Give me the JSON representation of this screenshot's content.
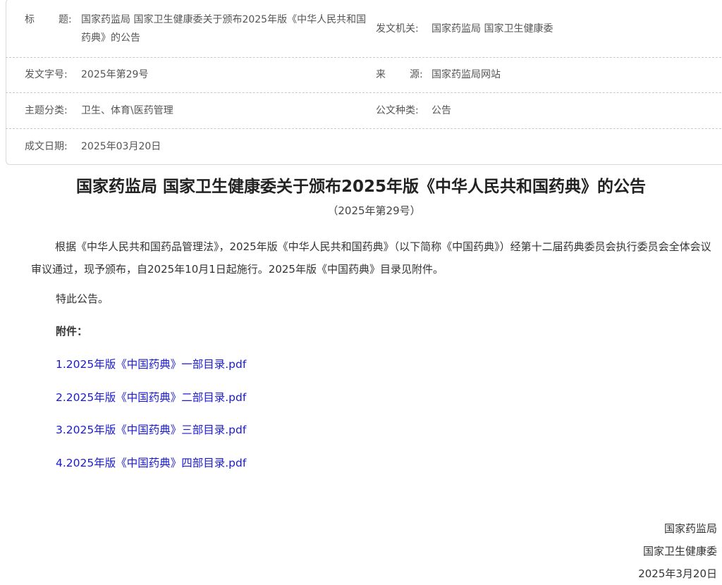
{
  "meta": {
    "title_label": "标题",
    "title_value_line1": "国家药监局 国家卫生健康委关于颁布2025年版《中华人民共和国",
    "title_value_line2": "药典》的公告",
    "issuer_label": "发文机关",
    "issuer_value": "国家药监局 国家卫生健康委",
    "doc_no_label": "发文字号",
    "doc_no_value": "2025年第29号",
    "source_label": "来源",
    "source_value": "国家药监局网站",
    "topic_label": "主题分类",
    "topic_value": "卫生、体育\\医药管理",
    "doc_type_label": "公文种类",
    "doc_type_value": "公告",
    "date_label": "成文日期",
    "date_value": "2025年03月20日",
    "colon": ":"
  },
  "article": {
    "title": "国家药监局 国家卫生健康委关于颁布2025年版《中华人民共和国药典》的公告",
    "subtitle": "（2025年第29号）",
    "body": "根据《中华人民共和国药品管理法》，2025年版《中华人民共和国药典》（以下简称《中国药典》）经第十二届药典委员会执行委员会全体会议审议通过，现予颁布，自2025年10月1日起施行。2025年版《中国药典》目录见附件。",
    "closing": "特此公告。",
    "attachments_heading": "附件：",
    "attachments": [
      {
        "num": "1.",
        "label": "2025年版《中国药典》一部目录.pdf"
      },
      {
        "num": "2.",
        "label": "2025年版《中国药典》二部目录.pdf"
      },
      {
        "num": "3.",
        "label": "2025年版《中国药典》三部目录.pdf"
      },
      {
        "num": "4.",
        "label": "2025年版《中国药典》四部目录.pdf"
      }
    ],
    "signature": [
      "国家药监局",
      "国家卫生健康委",
      "2025年3月20日"
    ]
  },
  "colors": {
    "link": "#1a1ad0",
    "text": "#333333",
    "border": "#d9d9d9"
  }
}
